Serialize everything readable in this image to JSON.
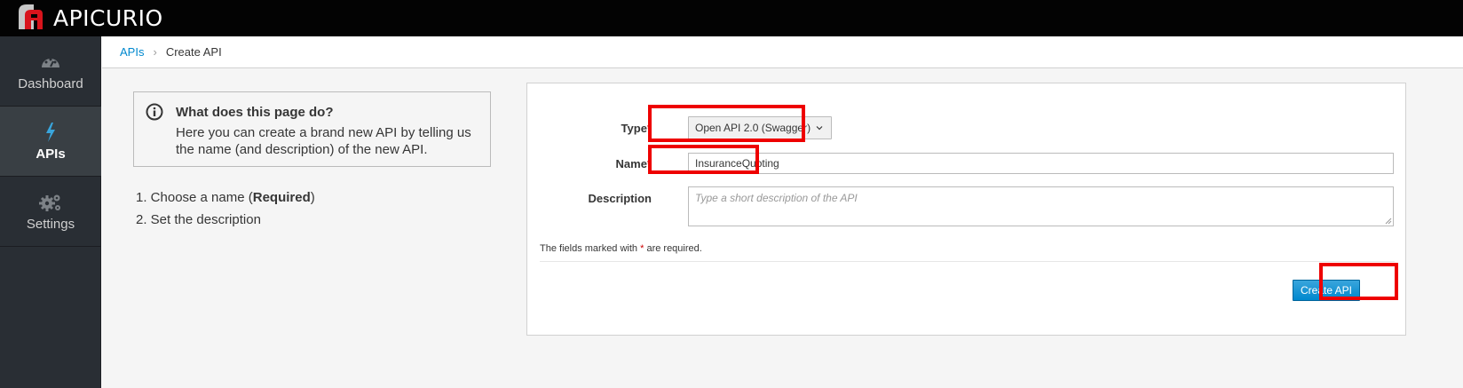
{
  "app": {
    "brand": "APICURIO"
  },
  "sidebar": {
    "items": [
      {
        "label": "Dashboard",
        "icon": "dashboard-icon",
        "active": false
      },
      {
        "label": "APIs",
        "icon": "bolt-icon",
        "active": true
      },
      {
        "label": "Settings",
        "icon": "gears-icon",
        "active": false
      }
    ]
  },
  "breadcrumb": {
    "parent": "APIs",
    "separator": "›",
    "current": "Create API"
  },
  "help": {
    "title": "What does this page do?",
    "text": "Here you can create a brand new API by telling us the name (and description) of the new API."
  },
  "steps": {
    "step1_prefix": "1. Choose a name (",
    "step1_bold": "Required",
    "step1_suffix": ")",
    "step2": "2. Set the description"
  },
  "form": {
    "type_label": "Type",
    "type_value": "Open API 2.0 (Swagger)",
    "name_label": "Name",
    "name_value": "InsuranceQuoting",
    "description_label": "Description",
    "description_placeholder": "Type a short description of the API",
    "required_marker": "*",
    "note_prefix": "The fields marked with ",
    "note_suffix": " are required.",
    "submit_label": "Create API"
  },
  "colors": {
    "accent": "#0088ce",
    "highlight": "#ee0000",
    "required": "#cc0000"
  }
}
